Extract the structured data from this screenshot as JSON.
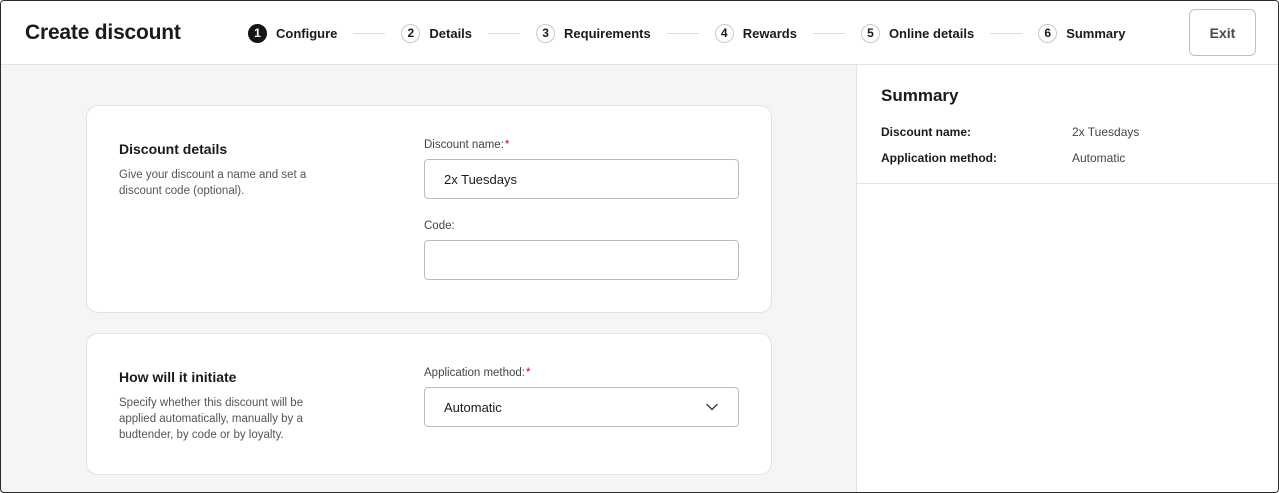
{
  "header": {
    "title": "Create discount",
    "exit_label": "Exit"
  },
  "steps": [
    {
      "num": "1",
      "label": "Configure",
      "active": true
    },
    {
      "num": "2",
      "label": "Details",
      "active": false
    },
    {
      "num": "3",
      "label": "Requirements",
      "active": false
    },
    {
      "num": "4",
      "label": "Rewards",
      "active": false
    },
    {
      "num": "5",
      "label": "Online details",
      "active": false
    },
    {
      "num": "6",
      "label": "Summary",
      "active": false
    }
  ],
  "discount_details": {
    "title": "Discount details",
    "description": "Give your discount a name and set a discount code (optional).",
    "name_label": "Discount name:",
    "required_mark": "*",
    "name_value": "2x Tuesdays",
    "code_label": "Code:",
    "code_value": ""
  },
  "initiate": {
    "title": "How will it initiate",
    "description": "Specify whether this discount will be applied automatically, manually by a budtender, by code or by loyalty.",
    "method_label": "Application method:",
    "required_mark": "*",
    "method_value": "Automatic"
  },
  "summary": {
    "title": "Summary",
    "rows": [
      {
        "key": "Discount name:",
        "value": "2x Tuesdays"
      },
      {
        "key": "Application method:",
        "value": "Automatic"
      }
    ]
  },
  "icons": {
    "select_chevron": "chevron-down-icon"
  },
  "colors": {
    "active_step": "#161616",
    "required": "#d0021b",
    "background": "#f4f5f4"
  }
}
